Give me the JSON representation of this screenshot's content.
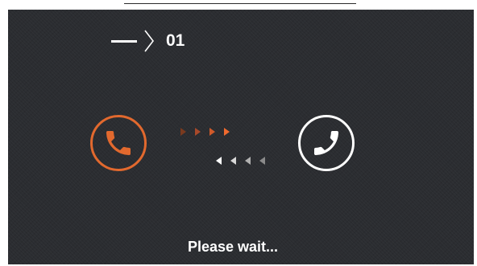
{
  "header": {
    "unit_number": "01",
    "dash_icon": "dash-icon",
    "chevron_icon": "chevron-right-icon"
  },
  "call": {
    "local_icon": "phone-handset-icon",
    "remote_icon": "phone-handset-icon",
    "outgoing_arrows": [
      "#7a3a1f",
      "#a8492a",
      "#d05a2a",
      "#f06a2e"
    ],
    "incoming_arrows": [
      "#ffffff",
      "#d8d8d8",
      "#b0b0b0",
      "#8a8a8a"
    ]
  },
  "status": {
    "text": "Please wait..."
  },
  "colors": {
    "background": "#2b2d31",
    "accent": "#e2692e",
    "foreground": "#ffffff"
  }
}
